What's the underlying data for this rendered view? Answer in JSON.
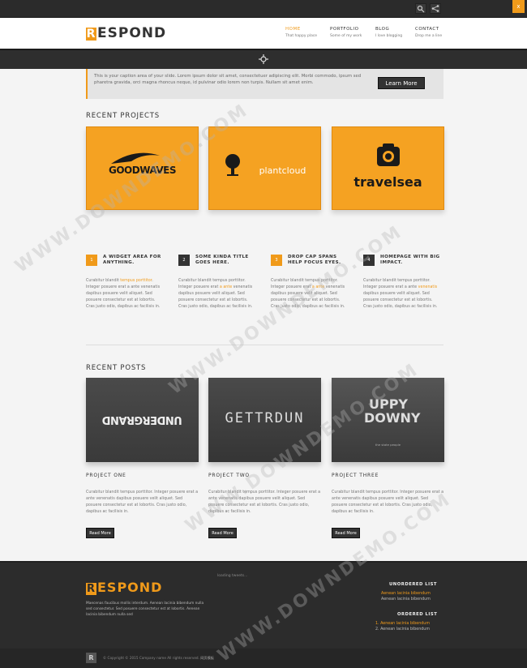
{
  "topbar": {
    "close_label": "x",
    "search_icon": "search-icon",
    "share_icon": "share-icon"
  },
  "header": {
    "logo_letter": "R",
    "logo_text": "ESPOND",
    "nav": [
      {
        "label": "HOME",
        "sub": "That happy place"
      },
      {
        "label": "PORTFOLIO",
        "sub": "Some of my work"
      },
      {
        "label": "BLOG",
        "sub": "I love blogging"
      },
      {
        "label": "CONTACT",
        "sub": "Drop me a line"
      }
    ]
  },
  "caption": {
    "text": "This is your caption area of your slide. Lorem ipsum dolor sit amet, consectetuer adipiscing elit. Morbi commodo, ipsum sed pharetra gravida, orci magna rhoncus neque, id pulvinar odio lorem non turpis. Nullam sit amet enim.",
    "button": "Learn More"
  },
  "recent_projects": {
    "title": "RECENT PROJECTS",
    "items": [
      "GOODWAVES",
      "plantcloud",
      "travelsea"
    ]
  },
  "features": [
    {
      "num": "1",
      "title": "A WIDGET AREA FOR ANYTHING.",
      "pre": "Curabitur blandit ",
      "hl": "tempus porttitor",
      "post": ". Integer posuere erat a ante venenatis dapibus posuere velit aliquet. Sed posuere consectetur est at lobortis. Cras justo odio, dapibus ac facilisis in."
    },
    {
      "num": "2",
      "title": "SOME KINDA TITLE GOES HERE.",
      "pre": "Curabitur blandit tempus porttitor. Integer posuere erat ",
      "hl": "a ante",
      "post": " venenatis dapibus posuere velit aliquet. Sed posuere consectetur est at lobortis. Cras justo odio, dapibus ac facilisis in."
    },
    {
      "num": "3",
      "title": "DROP CAP SPANS HELP FOCUS EYES.",
      "pre": "Curabitur blandit tempus porttitor. Integer posuere erat ",
      "hl": "a ante",
      "post": " venenatis dapibus posuere velit aliquet. Sed posuere consectetur est at lobortis. Cras justo odio, dapibus ac facilisis in."
    },
    {
      "num": "4",
      "title": "HOMEPAGE WITH BIG IMPACT.",
      "pre": "Curabitur blandit tempus porttitor. Integer posuere erat a ante ",
      "hl": "venenatis",
      "post": " dapibus posuere velit aliquet. Sed posuere consectetur est at lobortis. Cras justo odio, dapibus ac facilisis in."
    }
  ],
  "recent_posts": {
    "title": "RECENT POSTS",
    "items": [
      {
        "image_text": "UNDERGRAND",
        "name": "PROJECT ONE",
        "text": "Curabitur blandit tempus porttitor. Integer posuere erat a ante venenatis dapibus posuere velit aliquet. Sed posuere consectetur est at lobortis. Cras justo odio, dapibus ac facilisis in.",
        "button": "Read More"
      },
      {
        "image_text": "GETTRDUN",
        "name": "PROJECT TWO",
        "text": "Curabitur blandit tempus porttitor. Integer posuere erat a ante venenatis dapibus posuere velit aliquet. Sed posuere consectetur est at lobortis. Cras justo odio, dapibus ac facilisis in.",
        "button": "Read More"
      },
      {
        "image_text": "UPPY DOWNY",
        "image_sub": "the state people",
        "name": "PROJECT THREE",
        "text": "Curabitur blandit tempus porttitor. Integer posuere erat a ante venenatis dapibus posuere velit aliquet. Sed posuere consectetur est at lobortis. Cras justo odio, dapibus ac facilisis in.",
        "button": "Read More"
      }
    ]
  },
  "footer": {
    "logo_letter": "R",
    "logo_text": "ESPOND",
    "desc": "Maecenas faucibus mollis interdum. Aenean lacinia bibendum nulla sed consectetur. Sed posuere consectetur est at lobortis. Aenean lacinia bibendum nulla sed",
    "tweets": "loading tweets...",
    "ul_title": "UNORDERED LIST",
    "ul": [
      "Aenean lacinia bibendum",
      "Aenean lacinia bibendum"
    ],
    "ol_title": "ORDERED LIST",
    "ol": [
      "1. Aenean lacinia bibendum",
      "2. Aenean lacinia bibendum"
    ],
    "copyright": "© Copyright © 2015 Company name All rights reserved.",
    "copyright_link": "网页模板"
  },
  "watermark": "WWW.DOWNDEMO.COM",
  "colors": {
    "accent": "#f09a1a",
    "dark": "#2c2c2c"
  }
}
